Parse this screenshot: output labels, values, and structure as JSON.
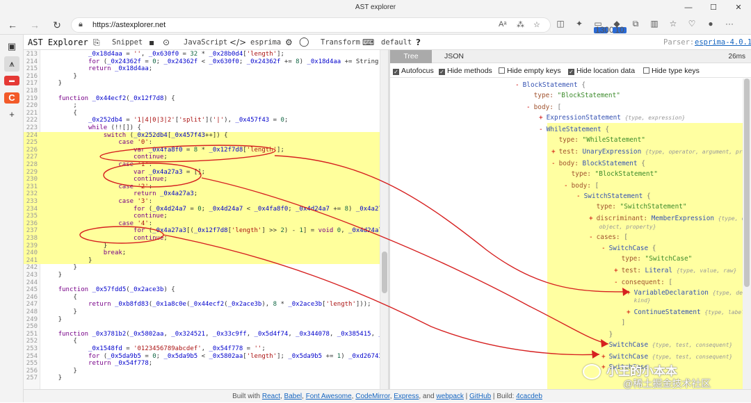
{
  "window": {
    "title": "AST explorer",
    "controls": {
      "min": "—",
      "max": "☐",
      "close": "✕"
    }
  },
  "browser": {
    "url": "https://astexplorer.net",
    "nav": {
      "back": "←",
      "forward": "→",
      "reload": "↻"
    },
    "address_icons": [
      "Aᵃ",
      "⁂",
      "☆"
    ],
    "tool_icons": [
      {
        "name": "favorites-icon",
        "glyph": "◫"
      },
      {
        "name": "extension-color-icon",
        "glyph": "✦"
      },
      {
        "name": "extension-badge-icon",
        "glyph": "▭",
        "badge": "1300"
      },
      {
        "name": "extension-red-icon",
        "glyph": "◆",
        "badge": "10"
      },
      {
        "name": "extensions-icon",
        "glyph": "⧉"
      },
      {
        "name": "split-screen-icon",
        "glyph": "▥"
      },
      {
        "name": "collections-icon",
        "glyph": "☆"
      },
      {
        "name": "browser-essentials-icon",
        "glyph": "♡"
      },
      {
        "name": "profile-avatar-icon",
        "glyph": "●"
      },
      {
        "name": "more-icon",
        "glyph": "···"
      }
    ]
  },
  "vertical_sidebar": [
    {
      "name": "sidebar-tab-icon",
      "glyph": "▣"
    },
    {
      "name": "sidebar-astexplorer-tab",
      "glyph": "⩚",
      "active": true
    },
    {
      "name": "sidebar-red-tab",
      "glyph": "▬"
    },
    {
      "name": "sidebar-csdn-tab",
      "glyph": "C"
    },
    {
      "name": "sidebar-add-tab",
      "glyph": "+"
    }
  ],
  "toolbar": {
    "brand": "AST Explorer",
    "snippet": "Snippet",
    "save_icon": "▪",
    "language": "JavaScript",
    "code_icon": "</>",
    "parser": "esprima",
    "settings_icon": "⚙",
    "transform": "Transform",
    "keyboard_icon": "⌨",
    "keymap": "default",
    "help": "?",
    "parser_label": "Parser:",
    "parser_version": "esprima-4.0.1"
  },
  "editor": {
    "lines": [
      {
        "n": "213",
        "code": "            _0x18d4aa = '', _0x630f0 = 32 * _0x28b0d4['length'];"
      },
      {
        "n": "214",
        "code": "            for (_0x24362f = 0; _0x24362f < _0x630f0; _0x24362f += 8) _0x18d4aa += String['fromC"
      },
      {
        "n": "215",
        "code": "            return _0x18d4aa;"
      },
      {
        "n": "216",
        "code": "        }"
      },
      {
        "n": "217",
        "code": "    }"
      },
      {
        "n": "218",
        "code": ""
      },
      {
        "n": "219",
        "code": "    function _0x44ecf2(_0x12f7d8) {"
      },
      {
        "n": "220",
        "code": "        ;"
      },
      {
        "n": "221",
        "code": "        {"
      },
      {
        "n": "222",
        "code": "            _0x252db4 = '1|4|0|3|2'['split']('|'), _0x457f43 = 0;"
      },
      {
        "n": "223",
        "code": "            while (!![]) {"
      },
      {
        "n": "224",
        "code": "                switch (_0x252db4[_0x457f43++]) {",
        "hl": true
      },
      {
        "n": "225",
        "code": "                    case '0':",
        "hl": true
      },
      {
        "n": "226",
        "code": "                        var _0x4fa8f0 = 8 * _0x12f7d8['length'];",
        "hl": true
      },
      {
        "n": "227",
        "code": "                        continue;",
        "hl": true
      },
      {
        "n": "228",
        "code": "                    case '1':",
        "hl": true
      },
      {
        "n": "229",
        "code": "                        var _0x4a27a3 = [];",
        "hl": true
      },
      {
        "n": "230",
        "code": "                        continue;",
        "hl": true
      },
      {
        "n": "231",
        "code": "                    case '2':",
        "hl": true
      },
      {
        "n": "232",
        "code": "                        return _0x4a27a3;",
        "hl": true
      },
      {
        "n": "233",
        "code": "                    case '3':",
        "hl": true
      },
      {
        "n": "234",
        "code": "                        for (_0x4d24a7 = 0; _0x4d24a7 < _0x4fa8f0; _0x4d24a7 += 8) _0x4a27a3[_0x",
        "hl": true
      },
      {
        "n": "235",
        "code": "                        continue;",
        "hl": true
      },
      {
        "n": "236",
        "code": "                    case '4':",
        "hl": true
      },
      {
        "n": "237",
        "code": "                        for (_0x4a27a3[(_0x12f7d8['length'] >> 2) - 1] = void 0, _0x4d24a7 = 0;",
        "hl": true
      },
      {
        "n": "238",
        "code": "                        continue;",
        "hl": true
      },
      {
        "n": "239",
        "code": "                }",
        "hl": true
      },
      {
        "n": "240",
        "code": "                break;",
        "hl": true
      },
      {
        "n": "241",
        "code": "            }",
        "hl": true
      },
      {
        "n": "242",
        "code": "        }"
      },
      {
        "n": "243",
        "code": "    }"
      },
      {
        "n": "244",
        "code": ""
      },
      {
        "n": "245",
        "code": "    function _0x57fdd5(_0x2ace3b) {"
      },
      {
        "n": "246",
        "code": "        {"
      },
      {
        "n": "247",
        "code": "            return _0xb8fd83(_0x1a8c0e(_0x44ecf2(_0x2ace3b), 8 * _0x2ace3b['length']));"
      },
      {
        "n": "248",
        "code": "        }"
      },
      {
        "n": "249",
        "code": "    }"
      },
      {
        "n": "250",
        "code": ""
      },
      {
        "n": "251",
        "code": "    function _0x3781b2(_0x5802aa, _0x324521, _0x33c9ff, _0x5d4f74, _0x344078, _0x385415, _0x160d"
      },
      {
        "n": "252",
        "code": "        {"
      },
      {
        "n": "253",
        "code": "            _0x1548fd = '0123456789abcdef', _0x54f778 = '';"
      },
      {
        "n": "254",
        "code": "            for (_0x5da9b5 = 0; _0x5da9b5 < _0x5802aa['length']; _0x5da9b5 += 1) _0xd26743 = _0x"
      },
      {
        "n": "255",
        "code": "            return _0x54f778;"
      },
      {
        "n": "256",
        "code": "        }"
      },
      {
        "n": "257",
        "code": "    }"
      }
    ]
  },
  "output": {
    "tabs": [
      {
        "label": "Tree",
        "active": true
      },
      {
        "label": "JSON",
        "active": false
      }
    ],
    "timing": "26ms",
    "options": [
      {
        "label": "Autofocus",
        "checked": true
      },
      {
        "label": "Hide methods",
        "checked": true
      },
      {
        "label": "Hide empty keys",
        "checked": false
      },
      {
        "label": "Hide location data",
        "checked": true
      },
      {
        "label": "Hide type keys",
        "checked": false
      }
    ],
    "tree": [
      {
        "toggle": "-",
        "key": "",
        "type": "BlockStatement",
        "hint": "",
        "brace": "{"
      },
      {
        "toggle": "",
        "key": "type:",
        "str": "\"BlockStatement\""
      },
      {
        "toggle": "-",
        "key": "body:",
        "brace": "["
      },
      {
        "toggle": "+",
        "key": "",
        "type": "ExpressionStatement",
        "hint": "{type, expression}"
      },
      {
        "toggle": "-",
        "key": "",
        "type": "WhileStatement",
        "hint": "",
        "brace": "{"
      },
      {
        "toggle": "",
        "key": "type:",
        "str": "\"WhileStatement\""
      },
      {
        "toggle": "+",
        "key": "test:",
        "type": "UnaryExpression",
        "hint": "{type, operator, argument, prefi"
      },
      {
        "toggle": "-",
        "key": "body:",
        "type": "BlockStatement",
        "hint": "",
        "brace": "{"
      },
      {
        "toggle": "",
        "key": "type:",
        "str": "\"BlockStatement\""
      },
      {
        "toggle": "-",
        "key": "body:",
        "brace": "["
      },
      {
        "toggle": "-",
        "key": "",
        "type": "SwitchStatement",
        "hint": "",
        "brace": "{"
      },
      {
        "toggle": "",
        "key": "type:",
        "str": "\"SwitchStatement\""
      },
      {
        "toggle": "+",
        "key": "discriminant:",
        "type": "MemberExpression",
        "hint": "{type, com"
      },
      {
        "toggle": "",
        "key": "",
        "hint": "object, property}"
      },
      {
        "toggle": "-",
        "key": "cases:",
        "brace": "["
      },
      {
        "toggle": "-",
        "key": "",
        "type": "SwitchCase",
        "hint": "",
        "brace": "{"
      },
      {
        "toggle": "",
        "key": "type:",
        "str": "\"SwitchCase\""
      },
      {
        "toggle": "+",
        "key": "test:",
        "type": "Literal",
        "hint": "{type, value, raw}"
      },
      {
        "toggle": "-",
        "key": "consequent:",
        "brace": "["
      },
      {
        "toggle": "+",
        "key": "",
        "type": "VariableDeclaration",
        "hint": "{type, decla"
      },
      {
        "toggle": "",
        "key": "",
        "hint": "kind}"
      },
      {
        "toggle": "+",
        "key": "",
        "type": "ContinueStatement",
        "hint": "{type, label}"
      },
      {
        "toggle": "",
        "key": "",
        "brace": "]"
      },
      {
        "toggle": "",
        "key": "",
        "brace": "}"
      },
      {
        "toggle": "+",
        "key": "",
        "type": "SwitchCase",
        "hint": "{type, test, consequent}"
      },
      {
        "toggle": "+",
        "key": "",
        "type": "SwitchCase",
        "hint": "{type, test, consequent}"
      },
      {
        "toggle": "+",
        "key": "",
        "type": "SwitchCase",
        "hint": ""
      }
    ]
  },
  "footer": {
    "prefix": "Built with",
    "links": [
      "React",
      "Babel",
      "Font Awesome",
      "CodeMirror",
      "Express"
    ],
    "and": ", and",
    "webpack": "webpack",
    "github": "GitHub",
    "build_label": "Build:",
    "build": "4cacdeb"
  },
  "watermark": {
    "line1": "小王的小本本",
    "line2": "@稀土掘金技术社区"
  },
  "colors": {
    "highlight": "#ffff9c",
    "annotation": "#d62020",
    "link": "#1565c0"
  }
}
